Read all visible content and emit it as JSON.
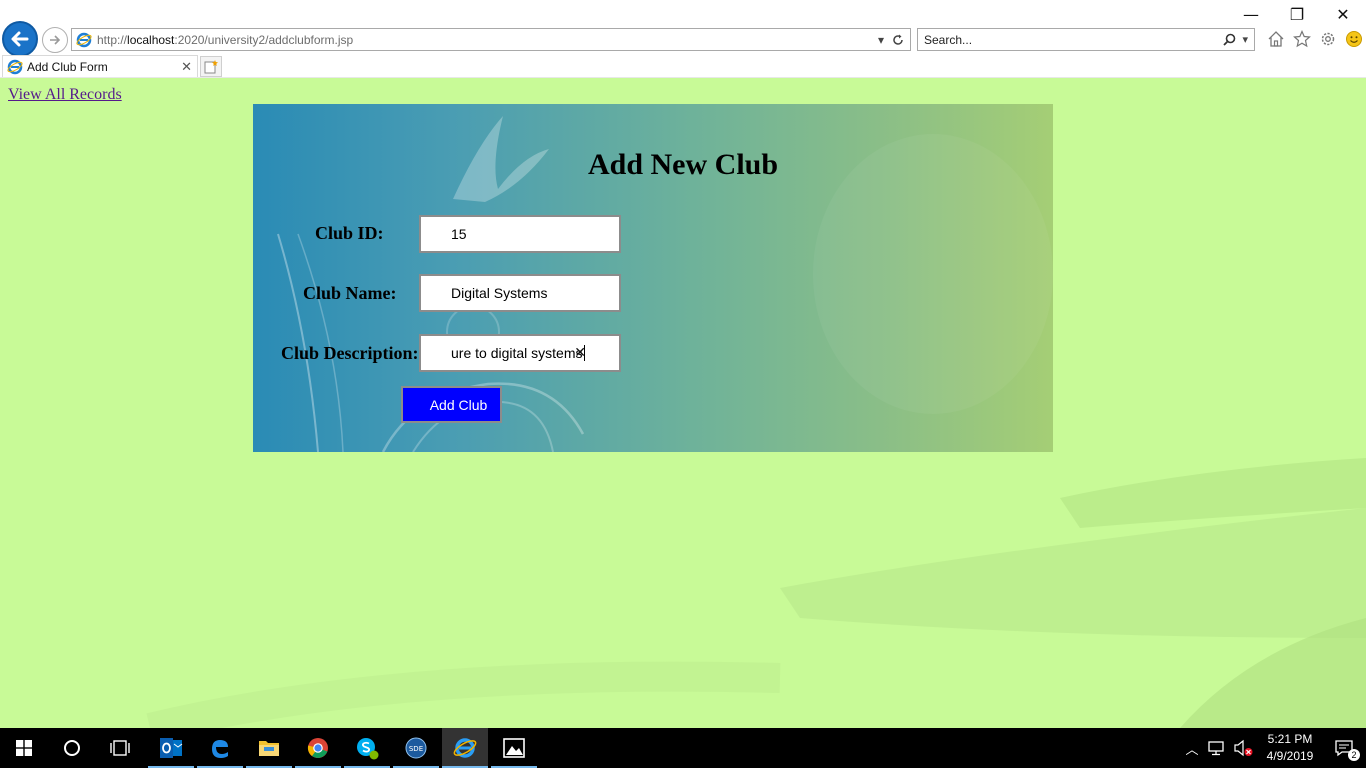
{
  "browser": {
    "url_prefix": "http://",
    "url_host": "localhost",
    "url_path": ":2020/university2/addclubform.jsp",
    "search_placeholder": "Search...",
    "tab_title": "Add Club Form",
    "icons": [
      "back-icon",
      "forward-icon",
      "ie-icon",
      "dropdown-icon",
      "refresh-icon",
      "search-icon",
      "home-icon",
      "favorites-star-icon",
      "settings-gear-icon",
      "feedback-smiley-icon",
      "close-icon",
      "new-tab-icon"
    ]
  },
  "window_controls": {
    "minimize": "—",
    "restore": "❐",
    "close": "✕"
  },
  "page": {
    "view_all_link": "View All Records",
    "form": {
      "title": "Add New Club",
      "fields": [
        {
          "label": "Club ID:",
          "value": "15"
        },
        {
          "label": "Club Name:",
          "value": "Digital Systems"
        },
        {
          "label": "Club Description:",
          "value": "ure to digital systems"
        }
      ],
      "submit_label": "Add Club"
    }
  },
  "taskbar": {
    "time": "5:21 PM",
    "date": "4/9/2019",
    "notification_count": "2",
    "apps": [
      "outlook-icon",
      "edge-icon",
      "file-explorer-icon",
      "chrome-icon",
      "skype-icon",
      "sde-icon",
      "internet-explorer-icon",
      "photos-icon"
    ]
  },
  "colors": {
    "page_background": "#c8fa97",
    "submit_button": "#0000ff",
    "link": "#551a8b"
  }
}
